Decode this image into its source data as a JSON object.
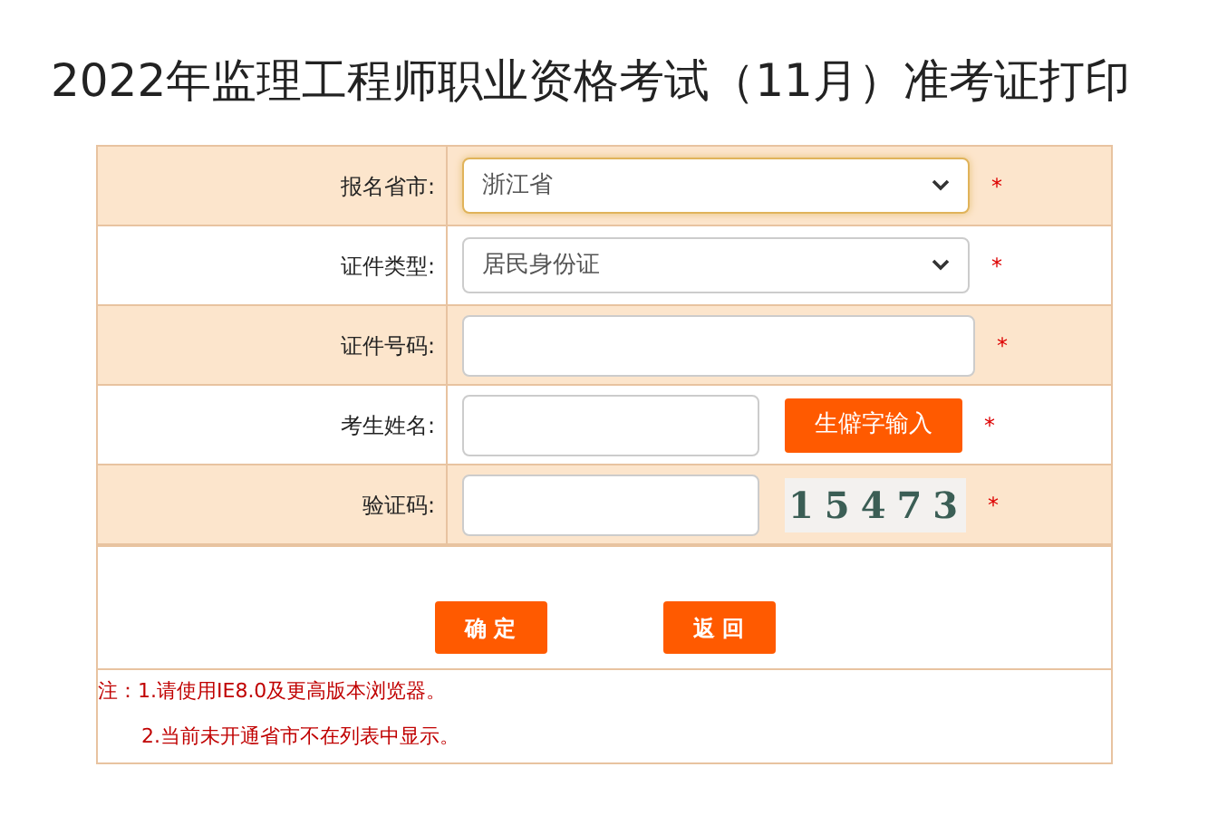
{
  "title": "2022年监理工程师职业资格考试（11月）准考证打印",
  "rows": [
    {
      "kind": "select",
      "label": "报名省市:",
      "value": "浙江省",
      "focused": true,
      "required": "*"
    },
    {
      "kind": "select",
      "label": "证件类型:",
      "value": "居民身份证",
      "focused": false,
      "required": "*"
    },
    {
      "kind": "input",
      "label": "证件号码:",
      "required": "*"
    },
    {
      "kind": "input_button",
      "label": "考生姓名:",
      "button": "生僻字输入",
      "required": "*"
    },
    {
      "kind": "captcha",
      "label": "验证码:",
      "captcha": "15473",
      "required": "*"
    }
  ],
  "buttons": [
    "确 定",
    "返 回"
  ],
  "notes": [
    "注：1.请使用IE8.0及更高版本浏览器。",
    "2.当前未开通省市不在列表中显示。"
  ]
}
